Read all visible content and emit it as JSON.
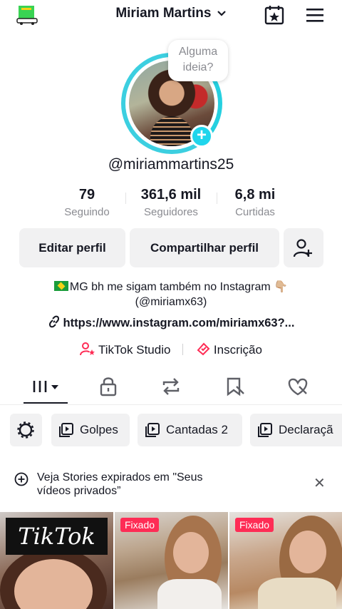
{
  "header": {
    "title": "Miriam Martins"
  },
  "bubble": {
    "line1": "Alguma",
    "line2": "ideia?"
  },
  "profile": {
    "username": "@miriammartins25"
  },
  "stats": [
    {
      "value": "79",
      "label": "Seguindo"
    },
    {
      "value": "361,6 mil",
      "label": "Seguidores"
    },
    {
      "value": "6,8 mi",
      "label": "Curtidas"
    }
  ],
  "buttons": {
    "edit": "Editar perfil",
    "share": "Compartilhar perfil"
  },
  "bio": {
    "line1": "MG bh me sigam também no Instagram 👇🏼",
    "line2": "(@miriamx63)",
    "link": "https://www.instagram.com/miriamx63?..."
  },
  "links": {
    "studio": "TikTok Studio",
    "subscription": "Inscrição"
  },
  "chips": [
    "Golpes",
    "Cantadas 2",
    "Declaraçã"
  ],
  "banner": {
    "line1": "Veja Stories expirados em \"Seus",
    "line2": "vídeos privados”"
  },
  "videos": [
    {
      "overlay": "TikTok"
    },
    {
      "badge": "Fixado"
    },
    {
      "badge": "Fixado"
    }
  ],
  "colors": {
    "accent": "#20d5ec",
    "pink": "#fe2c55",
    "muted": "#8a8b91"
  }
}
